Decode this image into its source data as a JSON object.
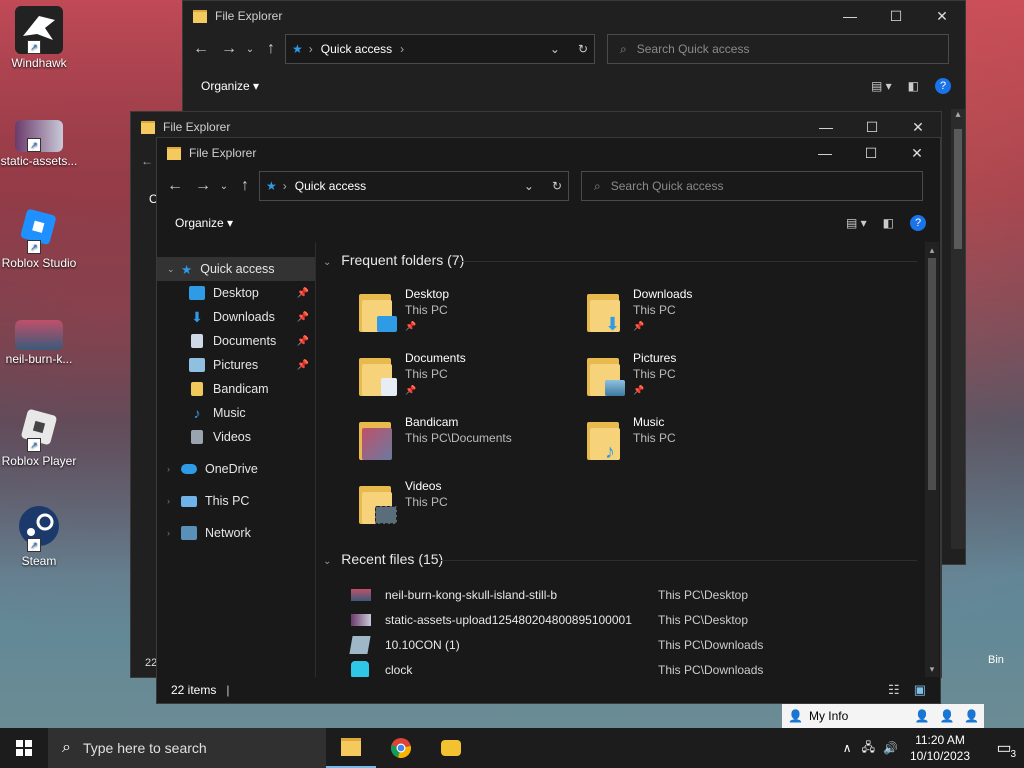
{
  "desktop": {
    "icons": [
      {
        "label": "Windhawk"
      },
      {
        "label": "static-assets..."
      },
      {
        "label": "Roblox Studio"
      },
      {
        "label": "neil-burn-k..."
      },
      {
        "label": "Roblox Player"
      },
      {
        "label": "Steam"
      }
    ],
    "peek_text_1": "Bin"
  },
  "back_window_1": {
    "title": "File Explorer",
    "address": "Quick access",
    "search_placeholder": "Search Quick access",
    "organize": "Organize"
  },
  "back_window_2": {
    "title": "File Explorer",
    "partial_nav": "O",
    "partial_status": "22"
  },
  "window": {
    "title": "File Explorer",
    "address": "Quick access",
    "search_placeholder": "Search Quick access",
    "organize": "Organize",
    "nav": {
      "quick_access": "Quick access",
      "items": [
        {
          "label": "Desktop",
          "pinned": true,
          "color": "#2f9be6"
        },
        {
          "label": "Downloads",
          "pinned": true,
          "color": "#2f9be6"
        },
        {
          "label": "Documents",
          "pinned": true,
          "color": "#cfd8e6"
        },
        {
          "label": "Pictures",
          "pinned": true,
          "color": "#8fc0e0"
        },
        {
          "label": "Bandicam",
          "pinned": false,
          "color": "#f2c75c"
        },
        {
          "label": "Music",
          "pinned": false,
          "color": "#2f9be6"
        },
        {
          "label": "Videos",
          "pinned": false,
          "color": "#9aa3b0"
        }
      ],
      "onedrive": "OneDrive",
      "thispc": "This PC",
      "network": "Network"
    },
    "frequent_header": "Frequent folders (7)",
    "folders": [
      {
        "name": "Desktop",
        "location": "This PC",
        "pinned": true,
        "overlay": "#2f9be6"
      },
      {
        "name": "Downloads",
        "location": "This PC",
        "pinned": true,
        "overlay": "#2f9be6"
      },
      {
        "name": "Documents",
        "location": "This PC",
        "pinned": true,
        "overlay": "#e6edf5"
      },
      {
        "name": "Pictures",
        "location": "This PC",
        "pinned": true,
        "overlay": "#8fc0e0"
      },
      {
        "name": "Bandicam",
        "location": "This PC\\Documents",
        "pinned": false,
        "overlay": "#c0506a"
      },
      {
        "name": "Music",
        "location": "This PC",
        "pinned": false,
        "overlay": "#2f9be6"
      },
      {
        "name": "Videos",
        "location": "This PC",
        "pinned": false,
        "overlay": "#5a6d7a"
      }
    ],
    "recent_header": "Recent files (15)",
    "recent": [
      {
        "name": "neil-burn-kong-skull-island-still-b",
        "path": "This PC\\Desktop"
      },
      {
        "name": "static-assets-upload125480204800895100001",
        "path": "This PC\\Desktop"
      },
      {
        "name": "10.10CON (1)",
        "path": "This PC\\Downloads"
      },
      {
        "name": "clock",
        "path": "This PC\\Downloads"
      }
    ],
    "status": "22 items"
  },
  "myinfo": {
    "label": "My Info"
  },
  "taskbar": {
    "search_placeholder": "Type here to search",
    "time": "11:20 AM",
    "date": "10/10/2023",
    "notification_count": "3"
  },
  "colors": {
    "accent": "#2f9be6",
    "window_bg": "#191919",
    "help": "#1a73e8"
  }
}
